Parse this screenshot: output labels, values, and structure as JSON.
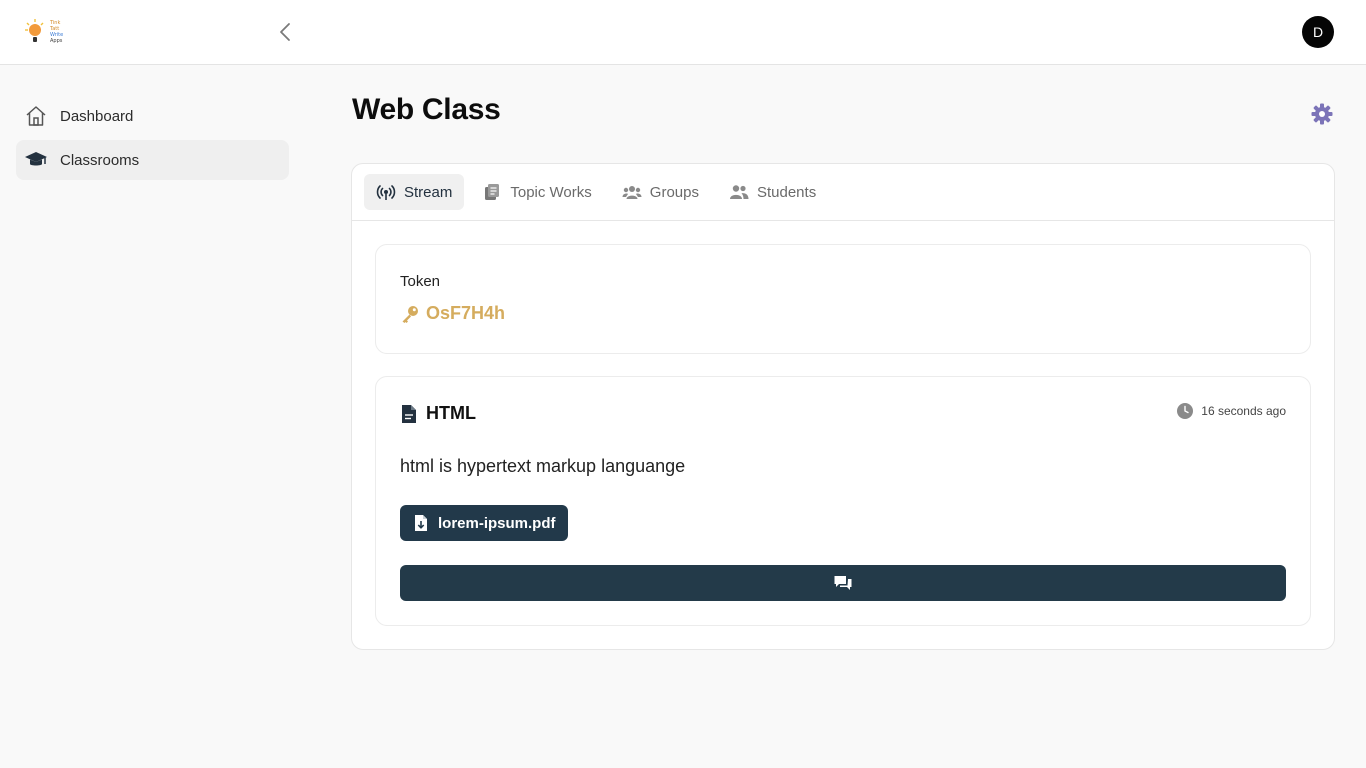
{
  "header": {
    "logo_lines": [
      "Tink",
      "Tatt",
      "Write",
      "Apps"
    ],
    "avatar_initial": "D"
  },
  "sidebar": {
    "items": [
      {
        "label": "Dashboard",
        "icon": "home-icon",
        "active": false
      },
      {
        "label": "Classrooms",
        "icon": "graduation-cap-icon",
        "active": true
      }
    ]
  },
  "page": {
    "title": "Web Class"
  },
  "tabs": [
    {
      "label": "Stream",
      "icon": "broadcast-icon",
      "active": true
    },
    {
      "label": "Topic Works",
      "icon": "clipboard-icon",
      "active": false
    },
    {
      "label": "Groups",
      "icon": "users-group-icon",
      "active": false
    },
    {
      "label": "Students",
      "icon": "user-pair-icon",
      "active": false
    }
  ],
  "token": {
    "label": "Token",
    "value": "OsF7H4h"
  },
  "post": {
    "title": "HTML",
    "time": "16 seconds ago",
    "body": "html is hypertext markup languange",
    "attachment": "lorem-ipsum.pdf"
  },
  "colors": {
    "accent_dark": "#22394a",
    "token_gold": "#d5ac5e",
    "settings_purple": "#7c74b8"
  }
}
